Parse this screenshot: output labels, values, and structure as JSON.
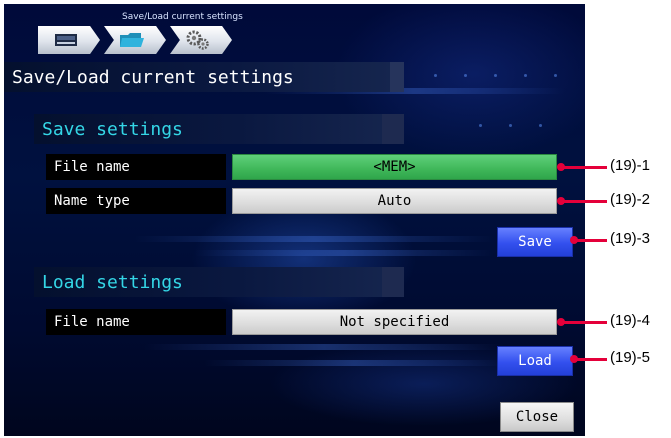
{
  "breadcrumb": "Save/Load current settings",
  "tabs": [
    {
      "icon": "memory-card-icon"
    },
    {
      "icon": "folder-icon"
    },
    {
      "icon": "gears-icon"
    }
  ],
  "page_title": "Save/Load current settings",
  "save_section": {
    "heading": "Save settings",
    "file_name_label": "File name",
    "file_name_value": "<MEM>",
    "name_type_label": "Name type",
    "name_type_value": "Auto",
    "save_button": "Save"
  },
  "load_section": {
    "heading": "Load settings",
    "file_name_label": "File name",
    "file_name_value": "Not specified",
    "load_button": "Load"
  },
  "close_button": "Close",
  "callouts": [
    "(19)-1",
    "(19)-2",
    "(19)-3",
    "(19)-4",
    "(19)-5"
  ],
  "colors": {
    "callout": "#e4003a",
    "selected_field": "#3fb759",
    "action_button": "#3350ee",
    "section_heading": "#34d6e6"
  }
}
